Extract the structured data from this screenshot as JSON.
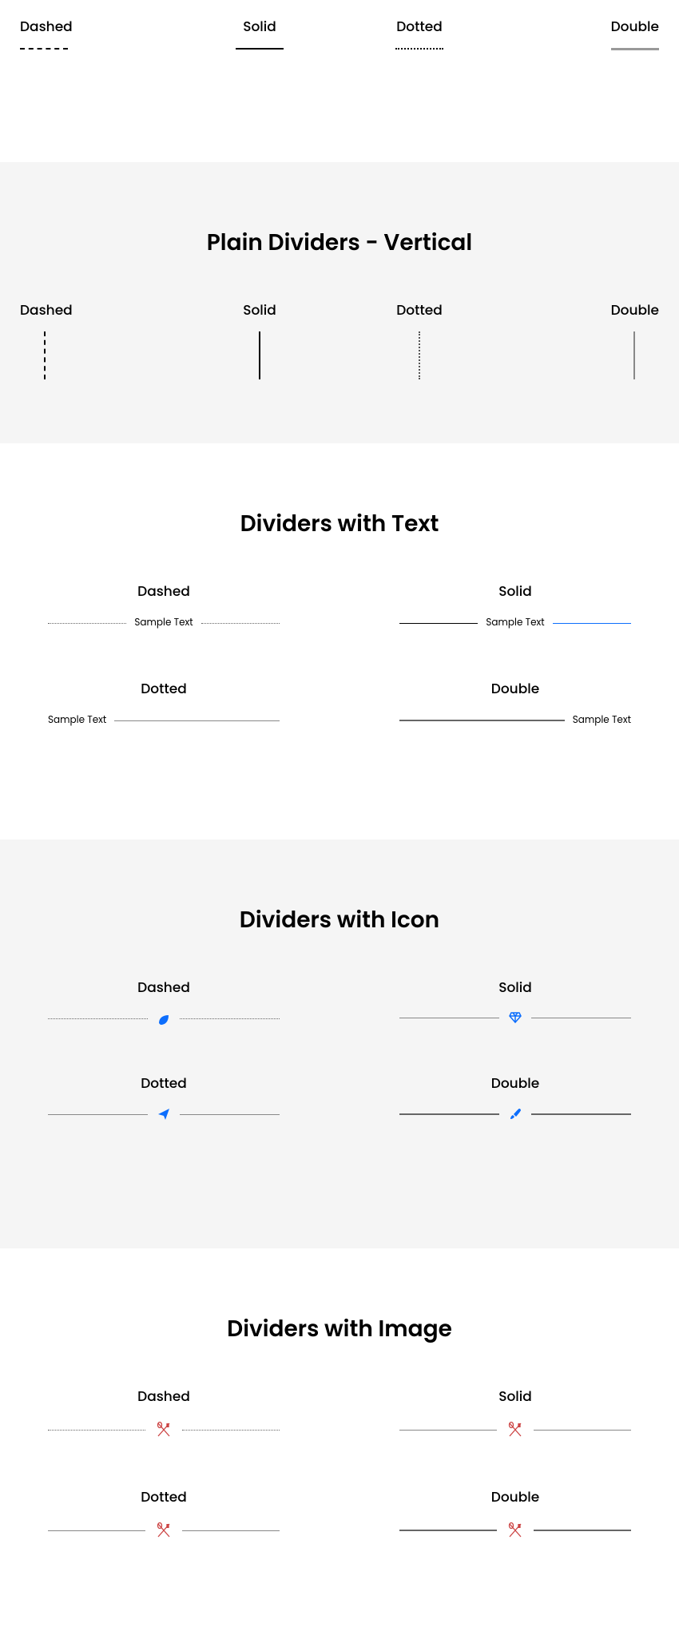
{
  "horizontal": {
    "labels": [
      "Dashed",
      "Solid",
      "Dotted",
      "Double"
    ]
  },
  "vertical": {
    "title": "Plain Dividers - Vertical",
    "labels": [
      "Dashed",
      "Solid",
      "Dotted",
      "Double"
    ]
  },
  "text": {
    "title": "Dividers with Text",
    "items": [
      {
        "label": "Dashed",
        "sample": "Sample Text"
      },
      {
        "label": "Solid",
        "sample": "Sample Text"
      },
      {
        "label": "Dotted",
        "sample": "Sample Text"
      },
      {
        "label": "Double",
        "sample": "Sample Text"
      }
    ]
  },
  "icon": {
    "title": "Dividers with Icon",
    "items": [
      {
        "label": "Dashed",
        "icon": "leaf"
      },
      {
        "label": "Solid",
        "icon": "gem"
      },
      {
        "label": "Dotted",
        "icon": "paper-plane"
      },
      {
        "label": "Double",
        "icon": "brush"
      }
    ]
  },
  "image": {
    "title": "Dividers with Image",
    "items": [
      {
        "label": "Dashed",
        "image": "utensils"
      },
      {
        "label": "Solid",
        "image": "utensils"
      },
      {
        "label": "Dotted",
        "image": "utensils"
      },
      {
        "label": "Double",
        "image": "utensils"
      }
    ]
  }
}
